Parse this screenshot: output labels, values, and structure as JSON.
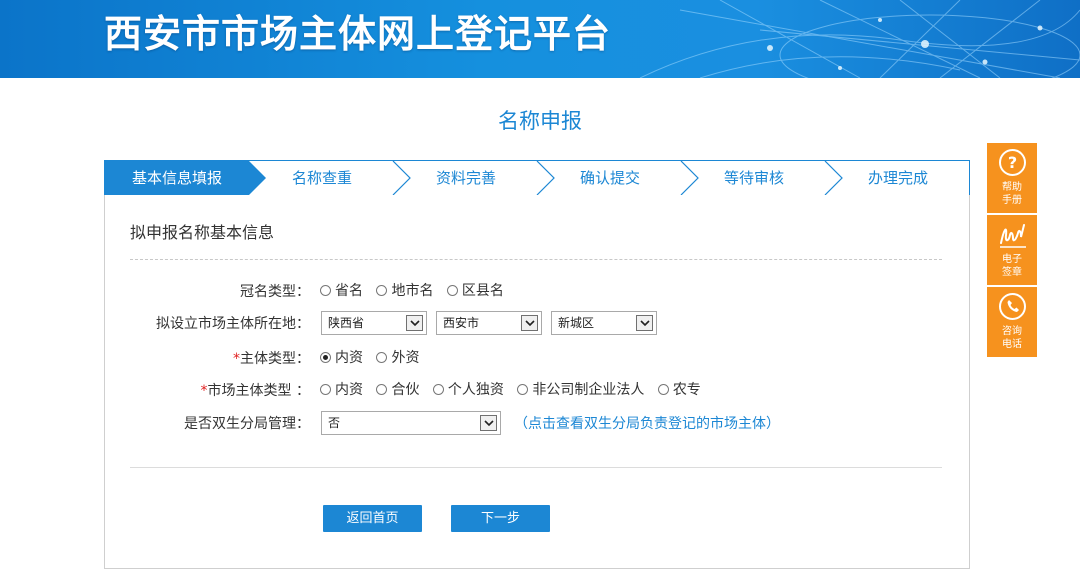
{
  "header": {
    "title": "西安市市场主体网上登记平台"
  },
  "page_title": "名称申报",
  "steps": [
    {
      "label": "基本信息填报",
      "active": true
    },
    {
      "label": "名称查重",
      "active": false
    },
    {
      "label": "资料完善",
      "active": false
    },
    {
      "label": "确认提交",
      "active": false
    },
    {
      "label": "等待审核",
      "active": false
    },
    {
      "label": "办理完成",
      "active": false
    }
  ],
  "section_title": "拟申报名称基本信息",
  "form": {
    "crown_type": {
      "label": "冠名类型：",
      "options": [
        "省名",
        "地市名",
        "区县名"
      ],
      "selected": null
    },
    "location": {
      "label": "拟设立市场主体所在地：",
      "province": "陕西省",
      "city": "西安市",
      "district": "新城区"
    },
    "entity_type": {
      "required_mark": "*",
      "label": "主体类型：",
      "options": [
        "内资",
        "外资"
      ],
      "selected": "内资"
    },
    "market_entity_type": {
      "required_mark": "*",
      "label": "市场主体类型 ：",
      "options": [
        "内资",
        "合伙",
        "个人独资",
        "非公司制企业法人",
        "农专"
      ],
      "selected": null
    },
    "shuangsheng": {
      "label": "是否双生分局管理：",
      "value": "否",
      "link_text": "（点击查看双生分局负责登记的市场主体）"
    }
  },
  "buttons": {
    "back": "返回首页",
    "next": "下一步"
  },
  "sidebar": [
    {
      "icon": "question-icon",
      "label_line1": "帮助",
      "label_line2": "手册"
    },
    {
      "icon": "signature-icon",
      "label_line1": "电子",
      "label_line2": "签章"
    },
    {
      "icon": "phone-icon",
      "label_line1": "咨询",
      "label_line2": "电话"
    }
  ],
  "colors": {
    "primary": "#1c87d4",
    "banner": "#0b74c9",
    "sidebar": "#f6921e",
    "required": "#e02020"
  }
}
